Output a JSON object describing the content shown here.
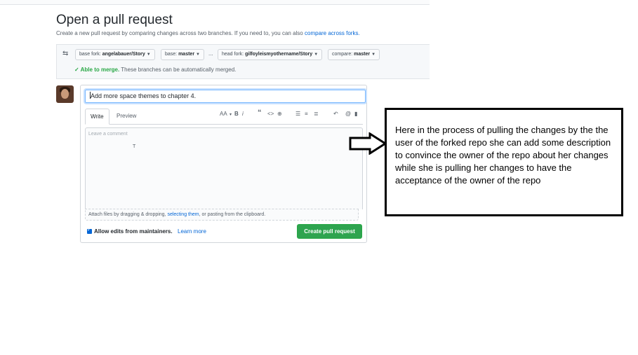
{
  "page": {
    "title": "Open a pull request",
    "subtitle": "Create a new pull request by comparing changes across two branches. If you need to, you can also",
    "subtitle_link": "compare across forks."
  },
  "compare": {
    "base_fork_label": "base fork:",
    "base_fork_value": "angelabauer/Story",
    "base_label": "base:",
    "base_value": "master",
    "ellipsis": "...",
    "head_fork_label": "head fork:",
    "head_fork_value": "gilfoyleismyothername/Story",
    "compare_label": "compare:",
    "compare_value": "master",
    "merge_status": "✓ Able to merge.",
    "merge_text": "These branches can be automatically merged."
  },
  "form": {
    "title_value": "Add more space themes to chapter 4.",
    "tabs": [
      "Write",
      "Preview"
    ],
    "toolbar": {
      "heading": "AA",
      "bold": "B",
      "italic": "i",
      "quote": "“",
      "code": "<>",
      "link": "⊕",
      "ul": "☰",
      "ol": "≡",
      "tasklist": "≣",
      "reply": "↶",
      "mention": "@",
      "bookmark": "▮"
    },
    "comment_placeholder": "Leave a comment",
    "text_cursor": "T",
    "attach_pre": "Attach files by dragging & dropping,",
    "attach_link": "selecting them",
    "attach_post": ", or pasting from the clipboard.",
    "allow_edits": "Allow edits from maintainers.",
    "learn_more": "Learn more",
    "create_button": "Create pull request"
  },
  "annotation": {
    "text": "Here in the process of pulling the changes by the the user of the forked repo she can add some description to convince the owner of the repo about her changes while she is pulling her changes to have the acceptance of the owner of the repo"
  },
  "colors": {
    "link": "#0366d6",
    "success": "#2ea44f",
    "check": "#28a745"
  }
}
